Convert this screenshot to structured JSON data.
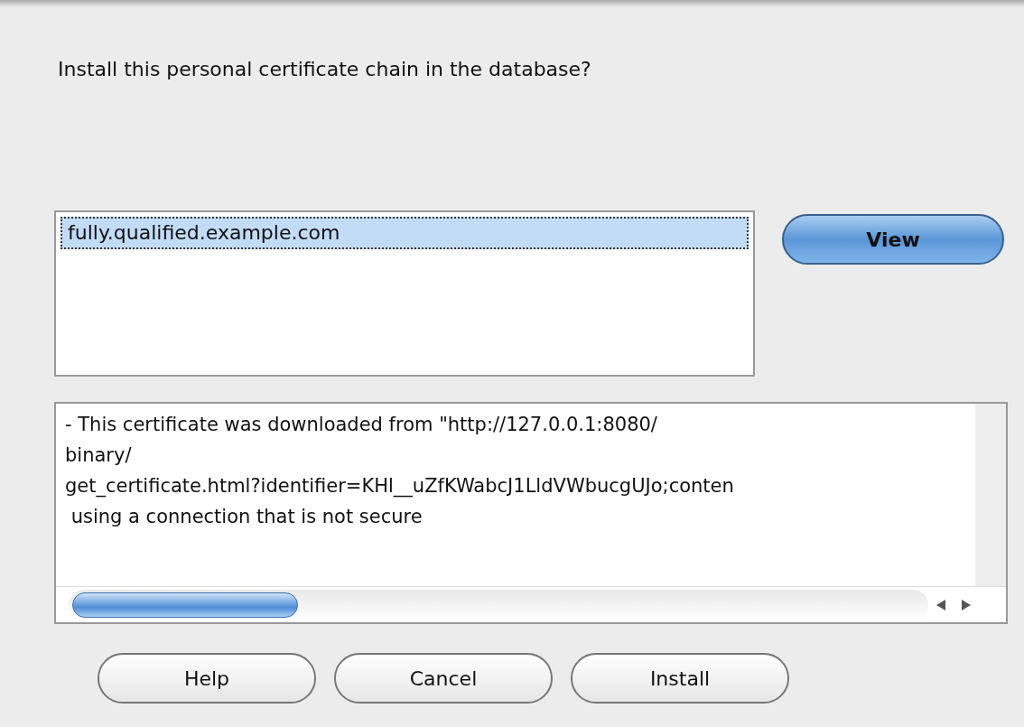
{
  "prompt": "Install this personal certificate chain in the database?",
  "certificates": [
    {
      "label": "fully.qualified.example.com",
      "selected": true
    }
  ],
  "view_button": "View",
  "details": [
    "- This certificate was downloaded from \"http://127.0.0.1:8080/",
    "binary/",
    "get_certificate.html?identifier=KHl__uZfKWabcJ1LldVWbucgUJo;conten",
    " using a connection that is not secure"
  ],
  "buttons": [
    {
      "label": "Help"
    },
    {
      "label": "Cancel"
    },
    {
      "label": "Install"
    }
  ]
}
